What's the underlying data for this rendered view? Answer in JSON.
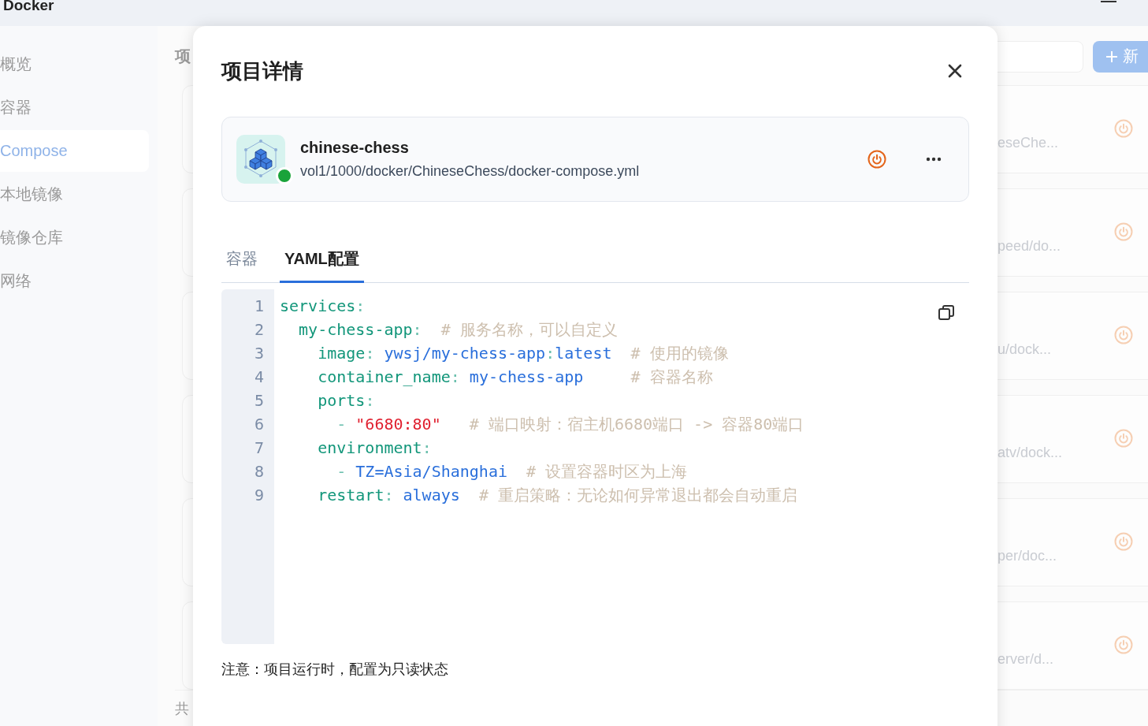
{
  "app": {
    "title": "Docker"
  },
  "sidebar": {
    "items": [
      {
        "label": "概览",
        "selected": false
      },
      {
        "label": "容器",
        "selected": false
      },
      {
        "label": "Compose",
        "selected": true
      },
      {
        "label": "本地镜像",
        "selected": false
      },
      {
        "label": "镜像仓库",
        "selected": false
      },
      {
        "label": "网络",
        "selected": false
      }
    ]
  },
  "main": {
    "heading": "项",
    "new_button": {
      "label": "新"
    },
    "projects": [
      {
        "path": "eseChe..."
      },
      {
        "path": "peed/do..."
      },
      {
        "path": "u/dock..."
      },
      {
        "path": "atv/dock..."
      },
      {
        "path": "per/doc..."
      },
      {
        "path": "erver/d..."
      }
    ],
    "footer": "共"
  },
  "modal": {
    "title": "项目详情",
    "project": {
      "name": "chinese-chess",
      "path": "vol1/1000/docker/ChineseChess/docker-compose.yml",
      "running": true
    },
    "tabs": [
      {
        "label": "容器",
        "selected": false
      },
      {
        "label": "YAML配置",
        "selected": true
      }
    ],
    "code": {
      "lines": [
        {
          "number": "1",
          "tokens": [
            {
              "kind": "key",
              "text": "services"
            },
            {
              "kind": "punct",
              "text": ":"
            }
          ]
        },
        {
          "number": "2",
          "tokens": [
            {
              "kind": "key",
              "text": "  my-chess-app"
            },
            {
              "kind": "punct",
              "text": ":"
            },
            {
              "kind": "comment",
              "text": "  # 服务名称，可以自定义"
            }
          ]
        },
        {
          "number": "3",
          "tokens": [
            {
              "kind": "key",
              "text": "    image"
            },
            {
              "kind": "punct",
              "text": ":"
            },
            {
              "kind": "value",
              "text": " ywsj/my-chess-app"
            },
            {
              "kind": "punct",
              "text": ":"
            },
            {
              "kind": "value",
              "text": "latest"
            },
            {
              "kind": "comment",
              "text": "  # 使用的镜像"
            }
          ]
        },
        {
          "number": "4",
          "tokens": [
            {
              "kind": "key",
              "text": "    container_name"
            },
            {
              "kind": "punct",
              "text": ":"
            },
            {
              "kind": "value",
              "text": " my-chess-app"
            },
            {
              "kind": "comment",
              "text": "     # 容器名称"
            }
          ]
        },
        {
          "number": "5",
          "tokens": [
            {
              "kind": "key",
              "text": "    ports"
            },
            {
              "kind": "punct",
              "text": ":"
            }
          ]
        },
        {
          "number": "6",
          "tokens": [
            {
              "kind": "punct",
              "text": "      - "
            },
            {
              "kind": "string",
              "text": "\"6680:80\""
            },
            {
              "kind": "comment",
              "text": "   # 端口映射：宿主机6680端口 -> 容器80端口"
            }
          ]
        },
        {
          "number": "7",
          "tokens": [
            {
              "kind": "key",
              "text": "    environment"
            },
            {
              "kind": "punct",
              "text": ":"
            }
          ]
        },
        {
          "number": "8",
          "tokens": [
            {
              "kind": "punct",
              "text": "      - "
            },
            {
              "kind": "value",
              "text": "TZ=Asia/Shanghai"
            },
            {
              "kind": "comment",
              "text": "  # 设置容器时区为上海"
            }
          ]
        },
        {
          "number": "9",
          "tokens": [
            {
              "kind": "key",
              "text": "    restart"
            },
            {
              "kind": "punct",
              "text": ":"
            },
            {
              "kind": "value",
              "text": " always"
            },
            {
              "kind": "comment",
              "text": "  # 重启策略：无论如何异常退出都会自动重启"
            }
          ]
        }
      ]
    },
    "note": "注意：项目运行时，配置为只读状态"
  }
}
